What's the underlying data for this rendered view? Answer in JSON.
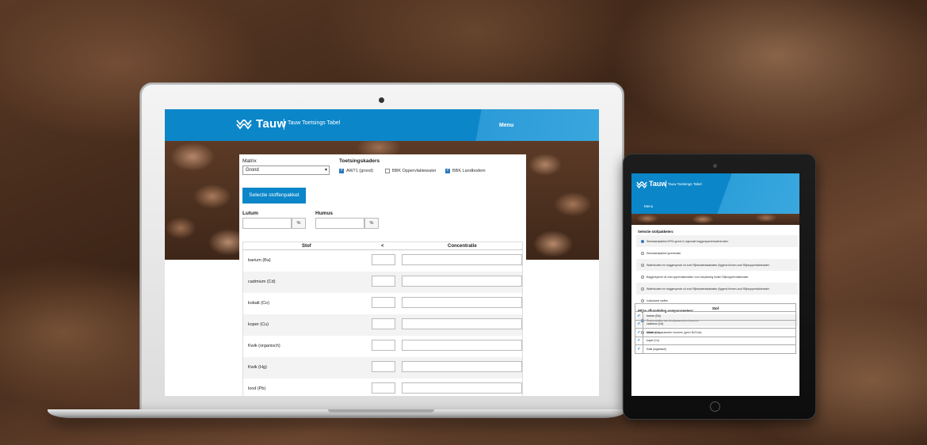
{
  "app": {
    "brand": "Tauw",
    "subtitle": "Tauw Toetsings Tabel",
    "menu_label": "Menu",
    "accent_color": "#0b86c9"
  },
  "form": {
    "matrix_label": "Matrix",
    "matrix_value": "Grond",
    "toetsingskaders_label": "Toetsingskaders",
    "kaders": [
      {
        "label": "AW71 (grond)",
        "checked": true
      },
      {
        "label": "BBK Oppervlaktewater",
        "checked": false
      },
      {
        "label": "BBK Landbodem",
        "checked": true
      }
    ],
    "selectie_button": "Selectie stoffenpakket",
    "lutum_label": "Lutum",
    "humus_label": "Humus",
    "percent_symbol": "%"
  },
  "table": {
    "col_stof": "Stof",
    "col_lt": "<",
    "col_conc": "Concentratie",
    "rows": [
      "barium (Ba)",
      "cadmium (Cd)",
      "kobalt (Co)",
      "koper (Cu)",
      "Kwik (organisch)",
      "Kwik (Hg)",
      "lood (Pb)"
    ]
  },
  "tablet": {
    "selectie_heading": "Selectie stofpakketen:",
    "selectie_options": [
      {
        "label": "Standaardpakket AP04 grond & regionale baggerspecie/waterbodem",
        "checked": true
      },
      {
        "label": "Standaardpakket grondwater",
        "checked": false
      },
      {
        "label": "Waterbodem en baggerspecie uit zoet Rijkswaterstaatwater (liggend binnen zoet Rijksoppervlaktewater",
        "checked": false
      },
      {
        "label": "Baggerspecie uit zoet oppervlaktewater voor toepassing buiten Rijksoppervlaktewater",
        "checked": false
      },
      {
        "label": "Waterbodem en baggerspecie uit zout Rijkswaterstaatwater (liggend binnen zout Rijksoppervlaktewater",
        "checked": false
      },
      {
        "label": "Individuele stoffen",
        "checked": false
      }
    ],
    "wijze_heading": "Wijze afhandeling somparameters:",
    "wijze_options": [
      {
        "label": "Concentraties van deelparameters invoeren",
        "checked": true
      },
      {
        "label": "Alleen somparameter invoeren (geen BoToVa)",
        "checked": false
      }
    ],
    "table_header": "Stof",
    "table_rows": [
      "barium (Ba)",
      "cadmium (Cd)",
      "kobalt (Co)",
      "koper (Cu)",
      "Kwik (organisch)"
    ]
  }
}
